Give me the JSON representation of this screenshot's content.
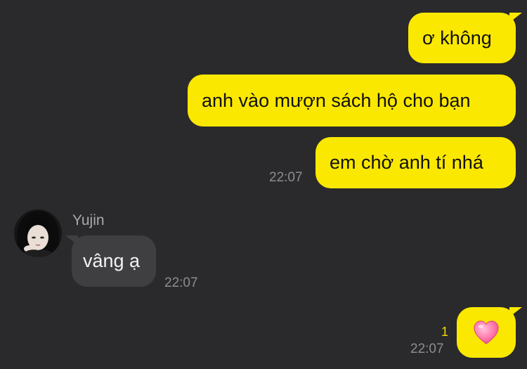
{
  "messages": {
    "m1": {
      "text": "ơ không"
    },
    "m2": {
      "text": "anh vào mượn sách hộ cho bạn"
    },
    "m3": {
      "text": "em chờ anh tí nhá",
      "time": "22:07"
    },
    "m4": {
      "sender": "Yujin",
      "text": "vâng ạ",
      "time": "22:07"
    },
    "m5": {
      "emoji": "pink-heart-icon",
      "unread": "1",
      "time": "22:07"
    }
  },
  "colors": {
    "background": "#2a2a2c",
    "outgoing_bubble": "#fbe800",
    "incoming_bubble": "#3f3f41",
    "unread_count": "#f5dc00"
  }
}
